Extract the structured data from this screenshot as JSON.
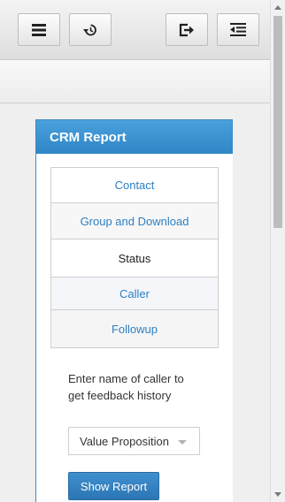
{
  "toolbar": {
    "buttons": [
      {
        "name": "menu",
        "icon": "hamburger-menu-icon"
      },
      {
        "name": "history",
        "icon": "history-icon"
      },
      {
        "name": "logout",
        "icon": "logout-icon"
      },
      {
        "name": "collapse",
        "icon": "outdent-list-icon"
      }
    ]
  },
  "panel": {
    "title": "CRM Report",
    "tabs": [
      {
        "label": "Contact",
        "active": false
      },
      {
        "label": "Group and Download",
        "active": false
      },
      {
        "label": "Status",
        "active": true
      },
      {
        "label": "Caller",
        "active": false
      },
      {
        "label": "Followup",
        "active": false
      }
    ],
    "prompt": "Enter name of caller to get feedback history",
    "select": {
      "value": "Value Proposition"
    },
    "button_label": "Show Report"
  },
  "colors": {
    "accent": "#2f86c6",
    "link": "#2d7fc0",
    "button": "#2c76b4"
  }
}
